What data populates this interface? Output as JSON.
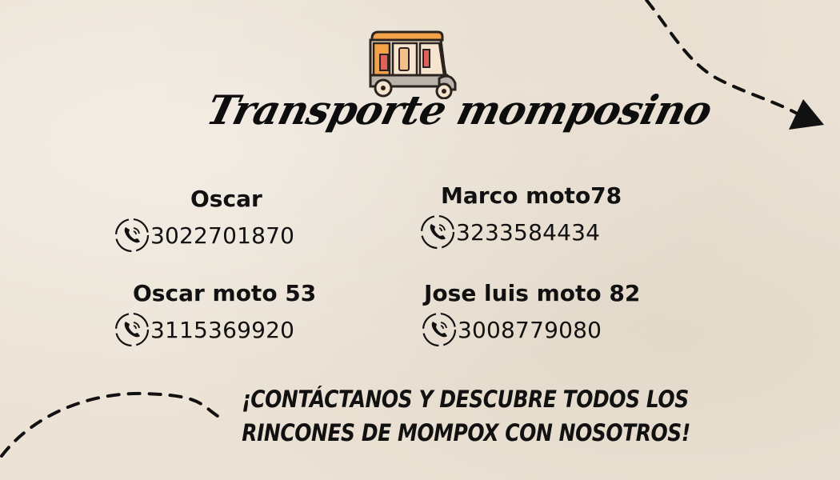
{
  "header": {
    "title": "Transporte momposino",
    "logo_icon": "mototaxi-icon"
  },
  "contacts": [
    {
      "name": "Oscar",
      "phone": "3022701870",
      "icon": "phone-icon"
    },
    {
      "name": "Marco moto78",
      "phone": "3233584434",
      "icon": "phone-icon"
    },
    {
      "name": "Oscar moto 53",
      "phone": "3115369920",
      "icon": "phone-icon"
    },
    {
      "name": "Jose luis moto 82",
      "phone": "3008779080",
      "icon": "phone-icon"
    }
  ],
  "cta": {
    "line1": "¡CONTÁCTANOS Y DESCUBRE TODOS LOS",
    "line2": "RINCONES DE MOMPOX CON NOSOTROS!"
  },
  "colors": {
    "background": "#ece3d6",
    "text": "#111111",
    "logo_orange": "#f3a24a",
    "logo_red": "#e0605a",
    "logo_gray": "#b9b3ab"
  }
}
